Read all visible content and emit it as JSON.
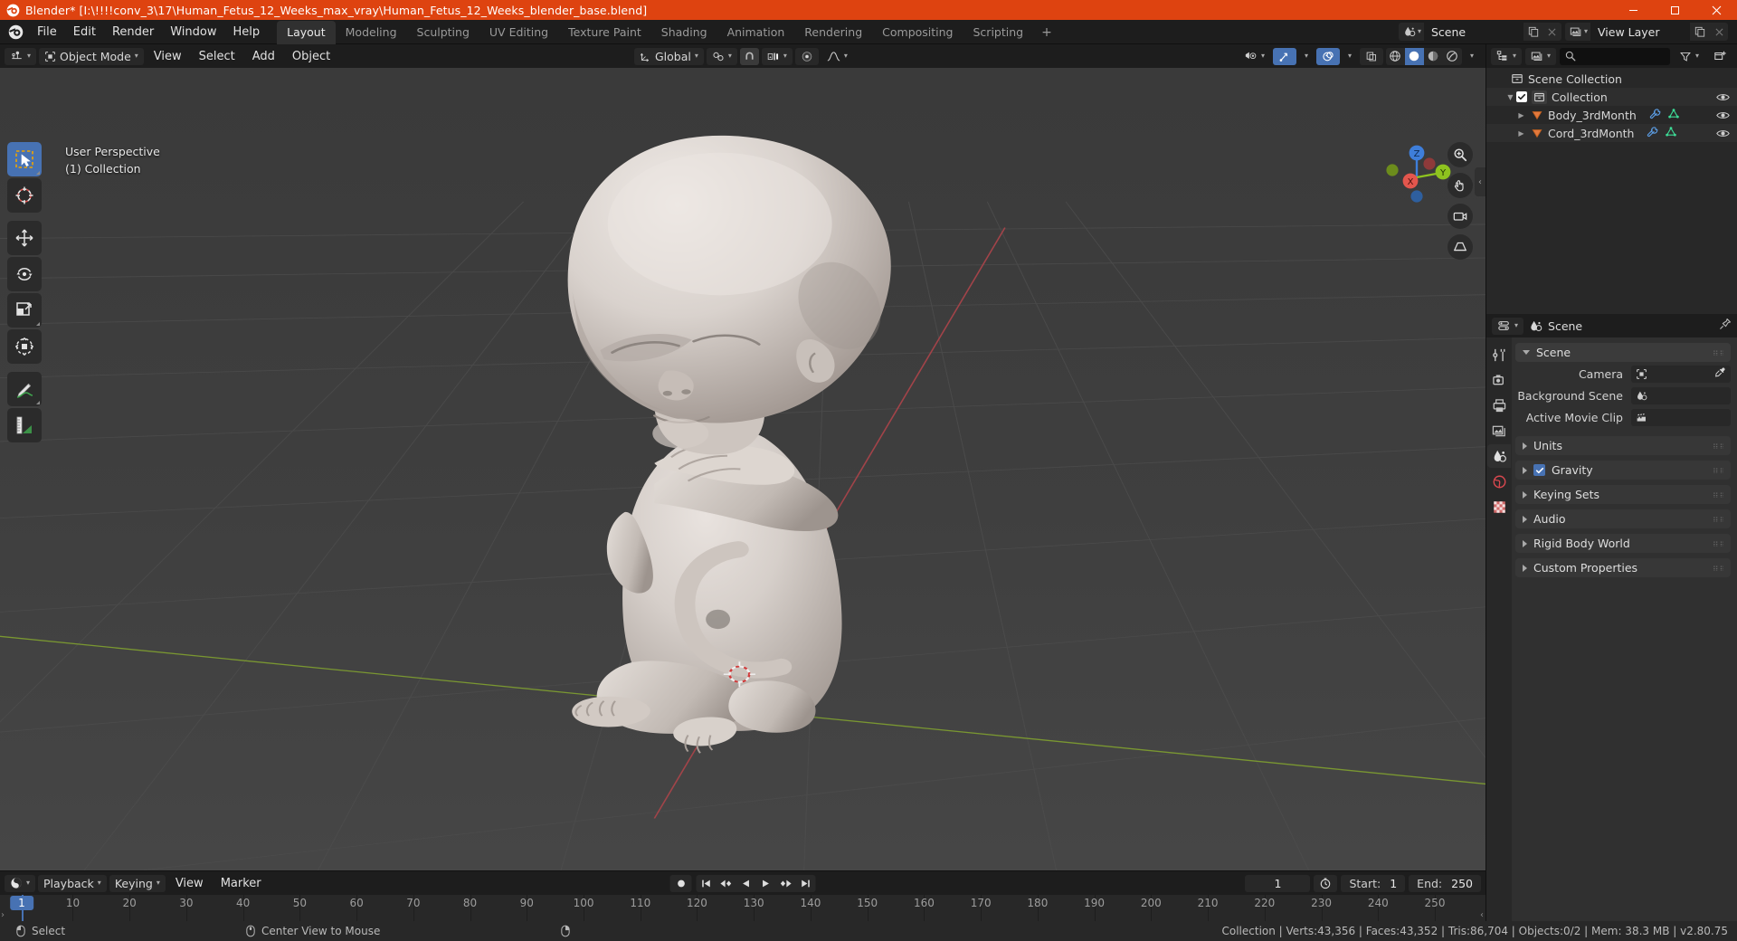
{
  "titlebar": {
    "app_icon": "blender-logo-icon",
    "text": "Blender* [I:\\!!!!conv_3\\17\\Human_Fetus_12_Weeks_max_vray\\Human_Fetus_12_Weeks_blender_base.blend]",
    "minimize": "–",
    "maximize": "❐",
    "close": "✕"
  },
  "topbar": {
    "menus": [
      "File",
      "Edit",
      "Render",
      "Window",
      "Help"
    ],
    "workspaces": [
      {
        "label": "Layout",
        "active": true
      },
      {
        "label": "Modeling",
        "active": false
      },
      {
        "label": "Sculpting",
        "active": false
      },
      {
        "label": "UV Editing",
        "active": false
      },
      {
        "label": "Texture Paint",
        "active": false
      },
      {
        "label": "Shading",
        "active": false
      },
      {
        "label": "Animation",
        "active": false
      },
      {
        "label": "Rendering",
        "active": false
      },
      {
        "label": "Compositing",
        "active": false
      },
      {
        "label": "Scripting",
        "active": false
      }
    ],
    "add_workspace": "+",
    "scene_name": "Scene",
    "view_layer_name": "View Layer"
  },
  "viewport": {
    "header": {
      "editor_type": "editor-type-3dview",
      "mode": "Object Mode",
      "menus": [
        "View",
        "Select",
        "Add",
        "Object"
      ],
      "transform_orientation": "Global",
      "snap_enabled": false,
      "proportional_enabled": false,
      "shading_modes": [
        "wireframe",
        "solid",
        "material-preview",
        "rendered"
      ],
      "shading_active": "solid"
    },
    "overlay_text": {
      "perspective": "User Perspective",
      "collection": "(1) Collection"
    },
    "tools": [
      {
        "name": "select-box",
        "active": true
      },
      {
        "name": "cursor",
        "active": false
      },
      {
        "name": "move",
        "active": false
      },
      {
        "name": "rotate",
        "active": false
      },
      {
        "name": "scale",
        "active": false
      },
      {
        "name": "transform",
        "active": false
      },
      {
        "name": "annotate",
        "active": false
      },
      {
        "name": "measure",
        "active": false
      }
    ],
    "gizmo_axes": [
      {
        "label": "Z",
        "color": "#3e7eda"
      },
      {
        "label": "Y",
        "color": "#8ec31f"
      },
      {
        "label": "X",
        "color": "#e3564d"
      }
    ],
    "grid_color": "#4a4a4a",
    "axis_x_color": "#b34a4a",
    "axis_y_color": "#7a9c2e",
    "background_top": "#3b3b3b",
    "background_bottom": "#424242"
  },
  "timeline": {
    "editor_type": "editor-type-timeline",
    "menus": [
      "Playback",
      "Keying",
      "View",
      "Marker"
    ],
    "current_frame": "1",
    "start_label": "Start:",
    "start_value": "1",
    "end_label": "End:",
    "end_value": "250",
    "ticks": [
      "10",
      "20",
      "30",
      "40",
      "50",
      "60",
      "70",
      "80",
      "90",
      "100",
      "110",
      "120",
      "130",
      "140",
      "150",
      "160",
      "170",
      "180",
      "190",
      "200",
      "210",
      "220",
      "230",
      "240",
      "250"
    ],
    "playhead_label": "1"
  },
  "outliner": {
    "display_mode": "view-layer",
    "filter_icon": "filter-icon",
    "new_collection_icon": "new-collection-icon",
    "search_placeholder": "",
    "rows": [
      {
        "name": "Scene Collection",
        "icon": "collection-icon",
        "indent": 0,
        "has_disclosure": false,
        "checkbox": false,
        "modifier_icons": [],
        "eye": false
      },
      {
        "name": "Collection",
        "icon": "collection-icon",
        "indent": 1,
        "has_disclosure": true,
        "checkbox": true,
        "modifier_icons": [],
        "eye": true
      },
      {
        "name": "Body_3rdMonth",
        "icon": "mesh-object-icon",
        "indent": 2,
        "has_disclosure": true,
        "checkbox": false,
        "modifier_icons": [
          "wrench-icon",
          "mesh-data-icon"
        ],
        "eye": true
      },
      {
        "name": "Cord_3rdMonth",
        "icon": "mesh-object-icon",
        "indent": 2,
        "has_disclosure": true,
        "checkbox": false,
        "modifier_icons": [
          "wrench-icon",
          "mesh-data-icon"
        ],
        "eye": true
      }
    ]
  },
  "properties": {
    "breadcrumb_icon": "scene-icon",
    "breadcrumb": "Scene",
    "pin_icon": "pin-icon",
    "tabs": [
      {
        "name": "tool",
        "active": false
      },
      {
        "name": "render",
        "active": false
      },
      {
        "name": "output",
        "active": false
      },
      {
        "name": "view-layer",
        "active": false
      },
      {
        "name": "scene",
        "active": true
      },
      {
        "name": "world",
        "active": false
      },
      {
        "name": "texture",
        "active": false
      }
    ],
    "scene_panel": {
      "title": "Scene",
      "fields": [
        {
          "label": "Camera",
          "icon": "camera-icon",
          "value": "",
          "dropper": true
        },
        {
          "label": "Background Scene",
          "icon": "scene-icon",
          "value": "",
          "dropper": false
        },
        {
          "label": "Active Movie Clip",
          "icon": "movieclip-icon",
          "value": "",
          "dropper": false
        }
      ]
    },
    "collapsed_panels": [
      {
        "title": "Units",
        "checkbox": false
      },
      {
        "title": "Gravity",
        "checkbox": true
      },
      {
        "title": "Keying Sets",
        "checkbox": false
      },
      {
        "title": "Audio",
        "checkbox": false
      },
      {
        "title": "Rigid Body World",
        "checkbox": false
      },
      {
        "title": "Custom Properties",
        "checkbox": false
      }
    ]
  },
  "statusbar": {
    "keymap": [
      {
        "icon": "mouse-left-icon",
        "label": "Select"
      },
      {
        "icon": "mouse-middle-icon",
        "label": "Center View to Mouse"
      },
      {
        "icon": "mouse-right-icon",
        "label": ""
      }
    ],
    "stats": "Collection | Verts:43,356 | Faces:43,352 | Tris:86,704 | Objects:0/2 | Mem: 38.3 MB | v2.80.75"
  }
}
